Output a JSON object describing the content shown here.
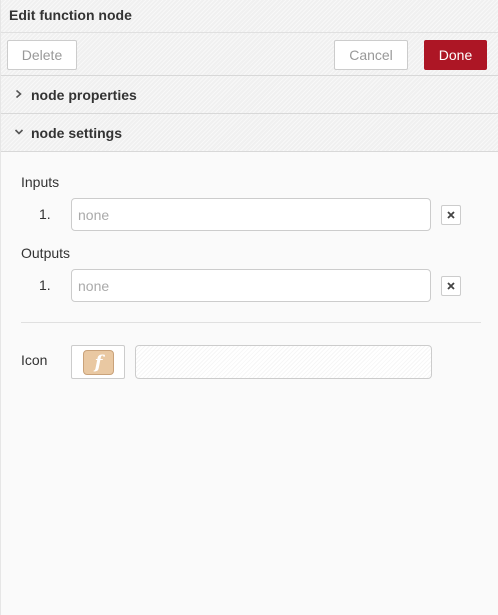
{
  "tray": {
    "title": "Edit function node"
  },
  "toolbar": {
    "delete_label": "Delete",
    "cancel_label": "Cancel",
    "done_label": "Done",
    "done_color": "#ad1625"
  },
  "sections": {
    "node_properties": {
      "label": "node properties",
      "icon": "chevron-right-icon",
      "expanded": false
    },
    "node_settings": {
      "label": "node settings",
      "icon": "chevron-down-icon",
      "expanded": true
    }
  },
  "settings": {
    "inputs": {
      "label": "Inputs",
      "rows": [
        {
          "number": "1.",
          "placeholder": "none",
          "value": ""
        }
      ]
    },
    "outputs": {
      "label": "Outputs",
      "rows": [
        {
          "number": "1.",
          "placeholder": "none",
          "value": ""
        }
      ]
    },
    "icon": {
      "label": "Icon",
      "glyph": "f",
      "icon": "function-icon",
      "swatch_color": "#e9c8a2",
      "name_value": ""
    }
  }
}
